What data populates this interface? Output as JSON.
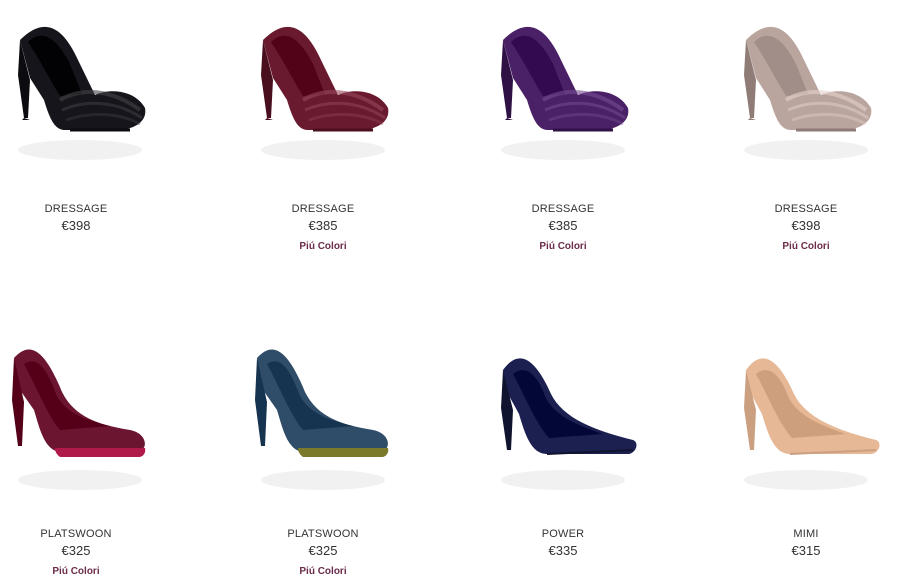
{
  "products": [
    {
      "name": "DRESSAGE",
      "price": "€398",
      "more": "",
      "color": "#15151b",
      "accent": "#0c0c10",
      "style": "peep"
    },
    {
      "name": "DRESSAGE",
      "price": "€385",
      "more": "Piú Colori",
      "color": "#6a1a2e",
      "accent": "#4a0f1f",
      "style": "peep"
    },
    {
      "name": "DRESSAGE",
      "price": "€385",
      "more": "Piú Colori",
      "color": "#4a2066",
      "accent": "#2f1145",
      "style": "peep"
    },
    {
      "name": "DRESSAGE",
      "price": "€398",
      "more": "Piú Colori",
      "color": "#b9a59e",
      "accent": "#8f7c77",
      "style": "peep"
    },
    {
      "name": "PLATSWOON",
      "price": "€325",
      "more": "Piú Colori",
      "color": "#6c1531",
      "accent": "#b01a4a",
      "style": "plat"
    },
    {
      "name": "PLATSWOON",
      "price": "€325",
      "more": "Piú Colori",
      "color": "#2f4c68",
      "accent": "#7a7a2a",
      "style": "plat"
    },
    {
      "name": "POWER",
      "price": "€335",
      "more": "",
      "color": "#1c2050",
      "accent": "#10132e",
      "style": "pump"
    },
    {
      "name": "MIMI",
      "price": "€315",
      "more": "",
      "color": "#e6b896",
      "accent": "#caa080",
      "style": "pump"
    }
  ]
}
